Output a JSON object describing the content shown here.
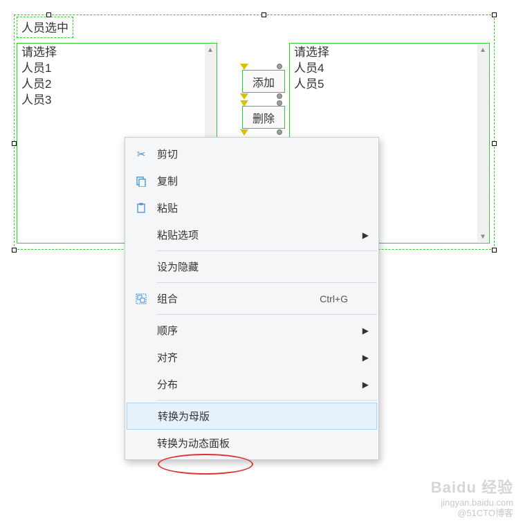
{
  "title": "人员选中",
  "listLeft": {
    "placeholder": "请选择",
    "items": [
      "人员1",
      "人员2",
      "人员3"
    ]
  },
  "listRight": {
    "placeholder": "请选择",
    "items": [
      "人员4",
      "人员5"
    ]
  },
  "buttons": {
    "add": "添加",
    "del": "删除"
  },
  "contextMenu": {
    "cut": "剪切",
    "copy": "复制",
    "paste": "粘贴",
    "pasteOptions": "粘贴选项",
    "setHidden": "设为隐藏",
    "group": "组合",
    "groupShortcut": "Ctrl+G",
    "order": "顺序",
    "align": "对齐",
    "distribute": "分布",
    "convertMaster": "转换为母版",
    "convertDynamic": "转换为动态面板"
  },
  "watermark": {
    "brand": "Baidu 经验",
    "url": "jingyan.baidu.com",
    "attr": "@51CTO博客"
  }
}
